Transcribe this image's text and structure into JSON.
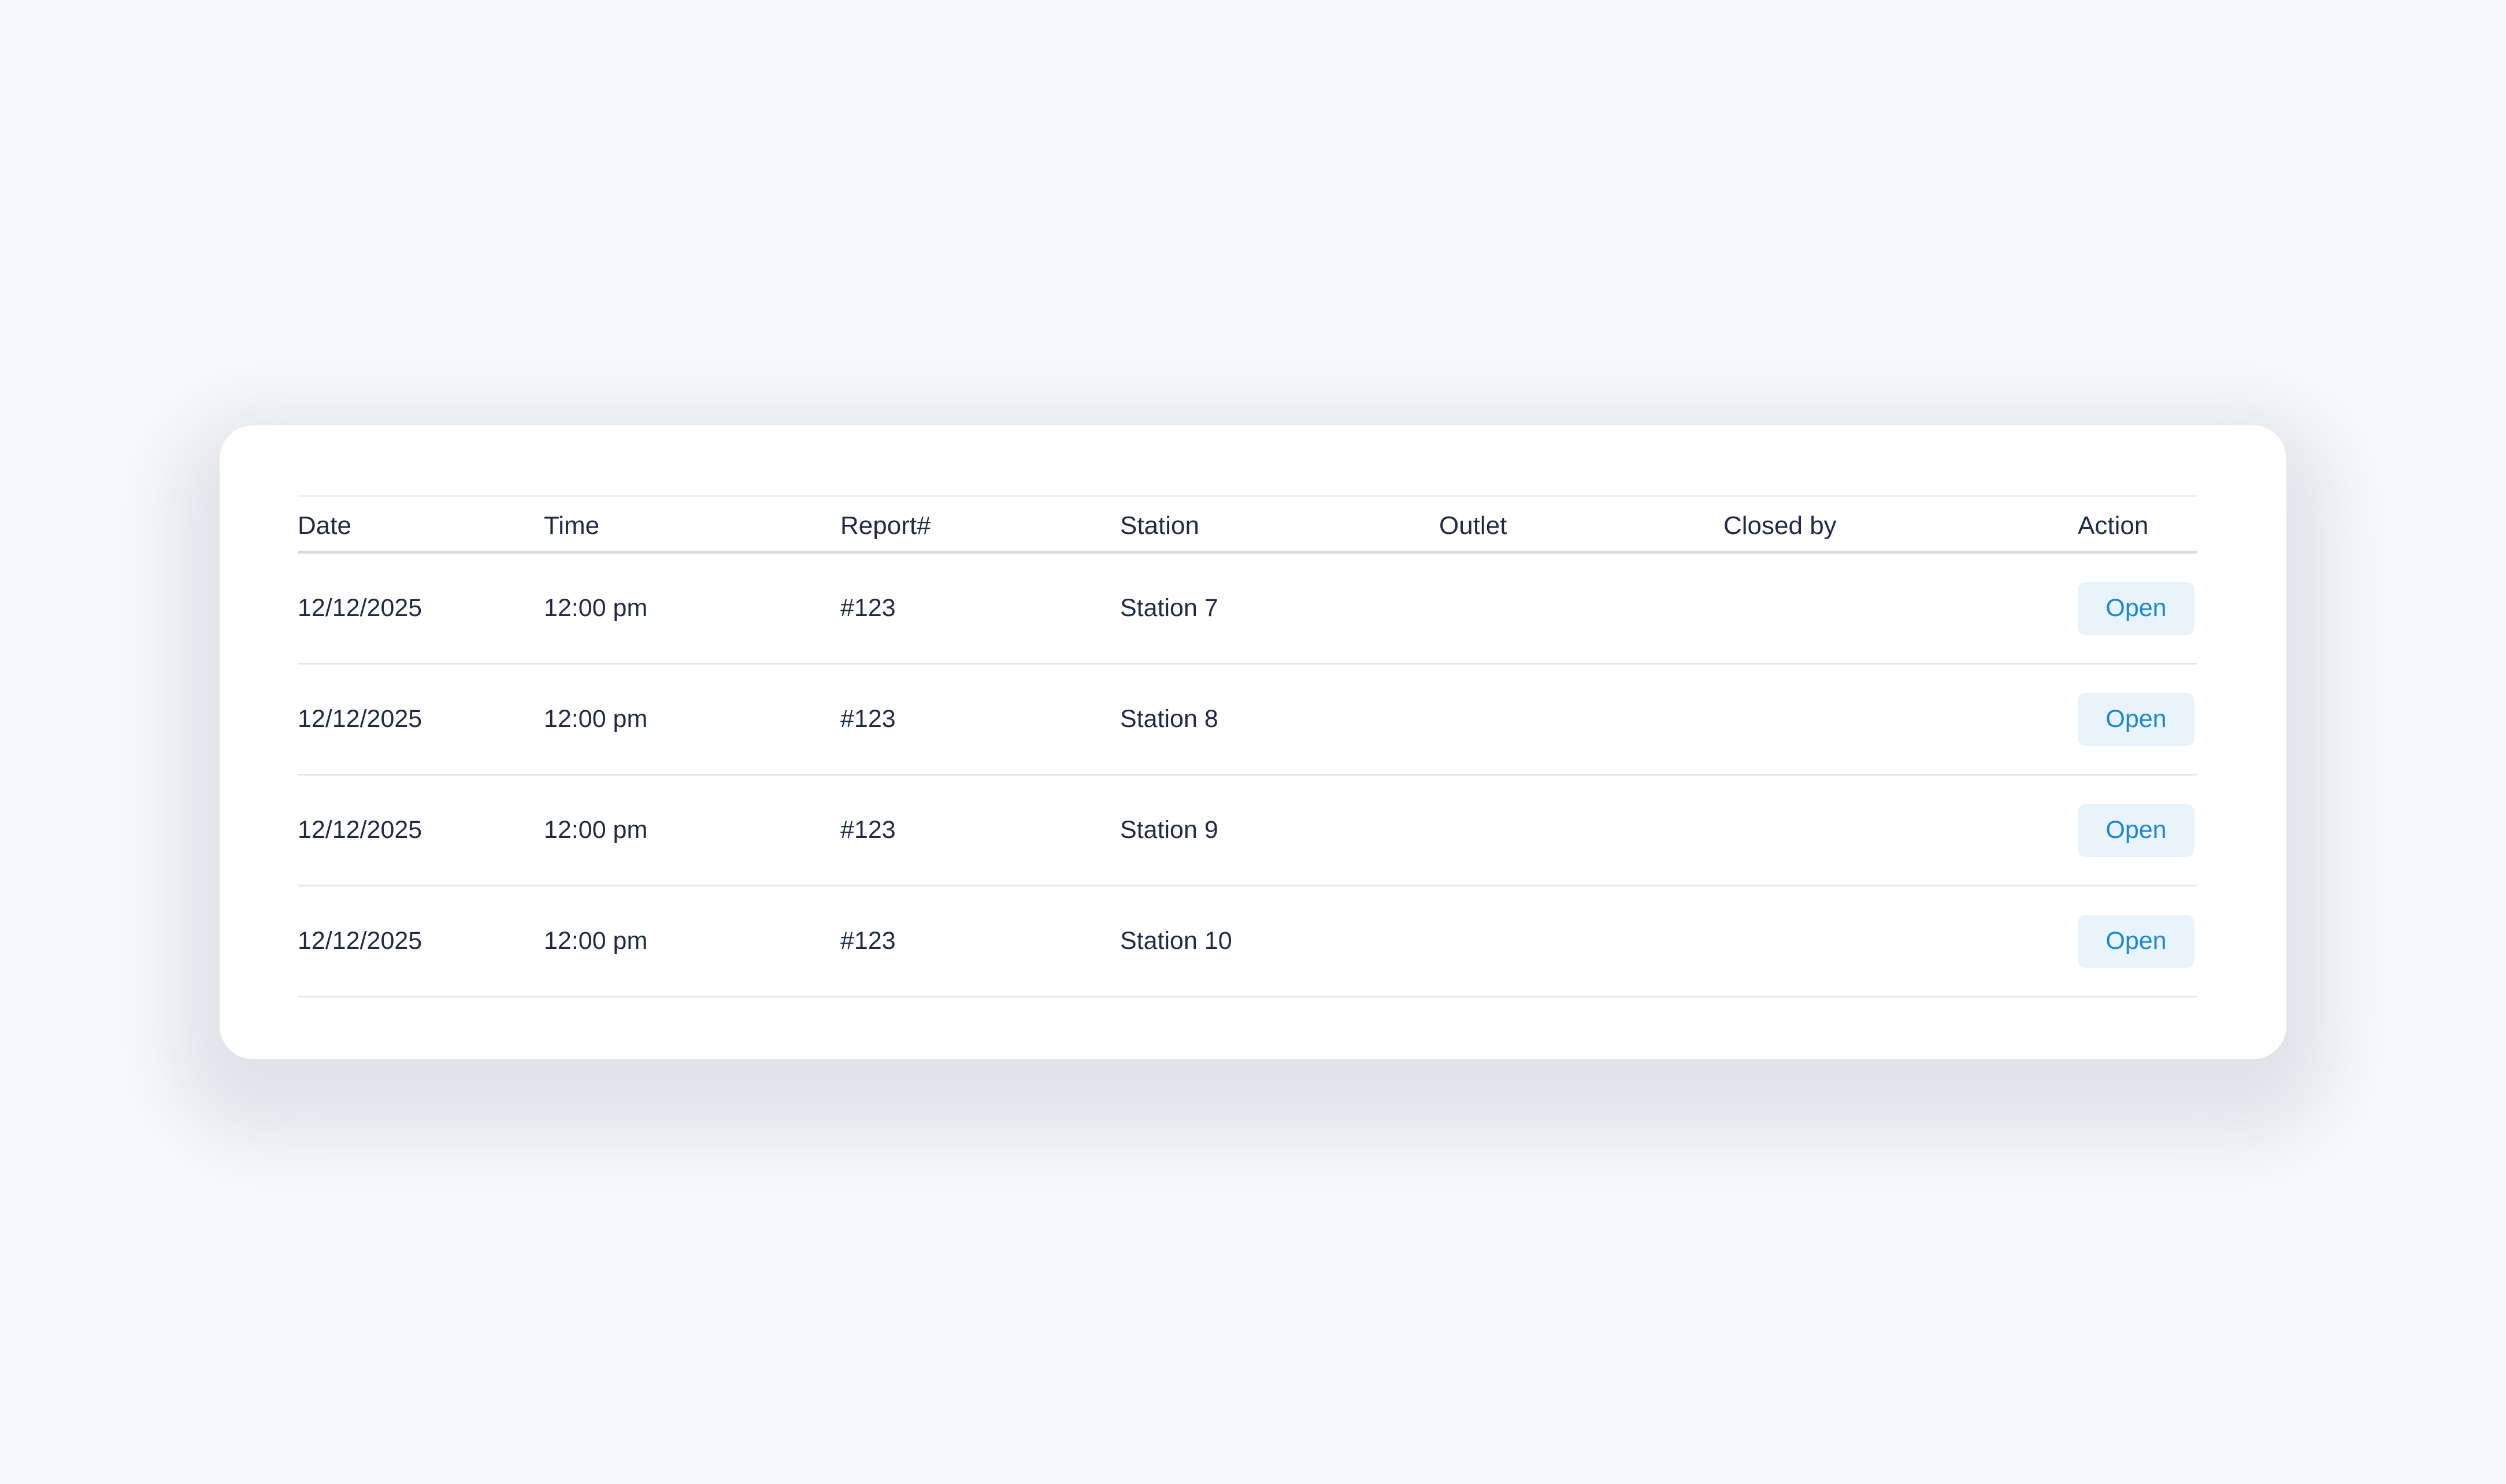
{
  "table": {
    "headers": {
      "date": "Date",
      "time": "Time",
      "report": "Report#",
      "station": "Station",
      "outlet": "Outlet",
      "closed_by": "Closed by",
      "action": "Action"
    },
    "rows": [
      {
        "date": "12/12/2025",
        "time": "12:00 pm",
        "report": "#123",
        "station": "Station 7",
        "outlet": "",
        "closed_by": "",
        "action": "Open"
      },
      {
        "date": "12/12/2025",
        "time": "12:00 pm",
        "report": "#123",
        "station": "Station 8",
        "outlet": "",
        "closed_by": "",
        "action": "Open"
      },
      {
        "date": "12/12/2025",
        "time": "12:00 pm",
        "report": "#123",
        "station": "Station 9",
        "outlet": "",
        "closed_by": "",
        "action": "Open"
      },
      {
        "date": "12/12/2025",
        "time": "12:00 pm",
        "report": "#123",
        "station": "Station 10",
        "outlet": "",
        "closed_by": "",
        "action": "Open"
      }
    ]
  },
  "colors": {
    "background": "#f8f9fb",
    "card": "#ffffff",
    "text": "#1f2b45",
    "action_button_bg": "#e8f3fc",
    "action_button_text": "#1b87d0"
  }
}
